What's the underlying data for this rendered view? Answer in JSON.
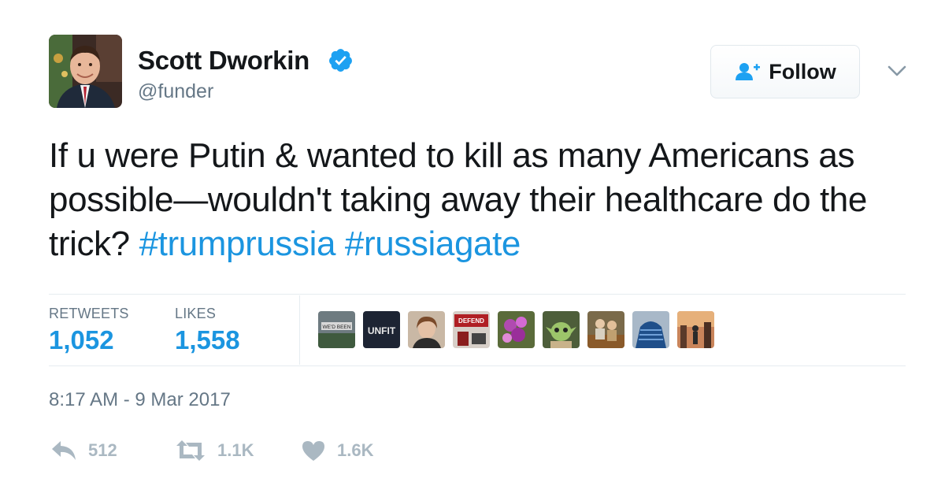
{
  "author": {
    "name": "Scott Dworkin",
    "handle": "@funder",
    "verified": true,
    "avatar_icon": "profile-photo"
  },
  "follow_button": {
    "label": "Follow",
    "icon": "add-user-icon"
  },
  "tweet": {
    "text_plain": "If u were Putin & wanted to kill as many Americans as possible—wouldn't taking away their healthcare do the trick?",
    "hashtags": [
      "#trumprussia",
      "#russiagate"
    ]
  },
  "stats": {
    "retweets_label": "RETWEETS",
    "retweets_value": "1,052",
    "likes_label": "LIKES",
    "likes_value": "1,558"
  },
  "likers": [
    {
      "icon": "liker-avatar-1",
      "text": "WE'D BEEN"
    },
    {
      "icon": "liker-avatar-2",
      "text": "UNFIT"
    },
    {
      "icon": "liker-avatar-3"
    },
    {
      "icon": "liker-avatar-4",
      "text": "DEFEND"
    },
    {
      "icon": "liker-avatar-5"
    },
    {
      "icon": "liker-avatar-6"
    },
    {
      "icon": "liker-avatar-7"
    },
    {
      "icon": "liker-avatar-8"
    },
    {
      "icon": "liker-avatar-9"
    }
  ],
  "timestamp": "8:17 AM - 9 Mar 2017",
  "actions": {
    "reply": {
      "count": "512",
      "icon": "reply-icon"
    },
    "retweet": {
      "count": "1.1K",
      "icon": "retweet-icon"
    },
    "like": {
      "count": "1.6K",
      "icon": "heart-icon"
    }
  },
  "colors": {
    "link_blue": "#1b95e0",
    "verified_blue": "#1da1f2",
    "muted_gray": "#657786",
    "action_gray": "#aab8c2"
  }
}
